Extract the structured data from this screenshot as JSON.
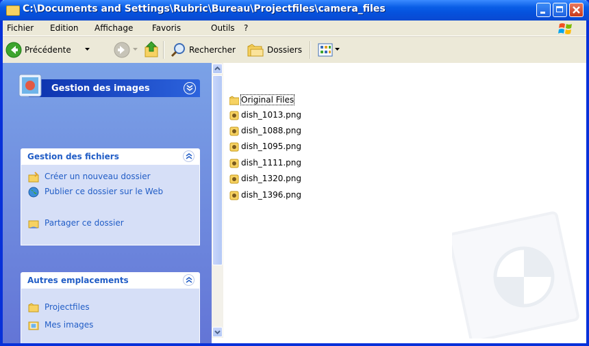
{
  "window": {
    "title": "C:\\Documents and Settings\\Rubric\\Bureau\\Projectfiles\\camera_files"
  },
  "menu": [
    "Fichier",
    "Edition",
    "Affichage",
    "Favoris",
    "Outils",
    "?"
  ],
  "toolbar": {
    "back": "Précédente",
    "search": "Rechercher",
    "folders": "Dossiers"
  },
  "sidebar": {
    "images_panel": {
      "title": "Gestion des images"
    },
    "file_tasks": {
      "title": "Gestion des fichiers",
      "items": [
        "Créer un nouveau dossier",
        "Publier ce dossier sur le Web",
        "Partager ce dossier"
      ]
    },
    "other_places": {
      "title": "Autres emplacements",
      "items": [
        "Projectfiles",
        "Mes images"
      ]
    }
  },
  "files": [
    "Original Files",
    "dish_1013.png",
    "dish_1088.png",
    "dish_1095.png",
    "dish_1111.png",
    "dish_1320.png",
    "dish_1396.png"
  ],
  "colors": {
    "title_bar": "#0A5EE6",
    "task_pane": "#7BA2E7",
    "link": "#215DC6"
  }
}
